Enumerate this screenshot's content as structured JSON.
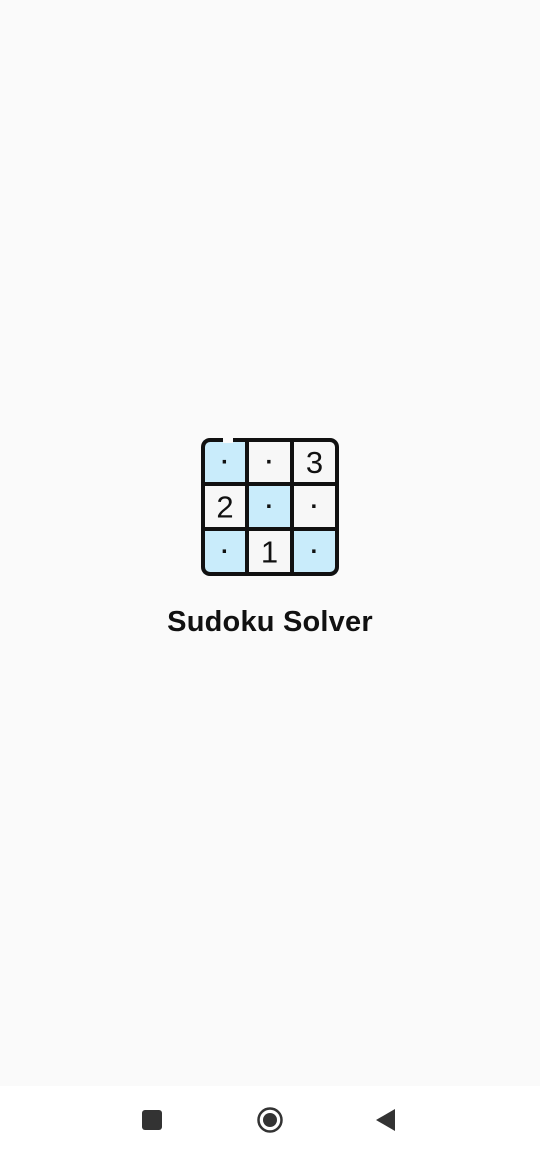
{
  "app": {
    "title": "Sudoku Solver"
  },
  "logo": {
    "icon": "sudoku-grid-icon",
    "cells": [
      {
        "value": "·",
        "shaded": true
      },
      {
        "value": "·",
        "shaded": false
      },
      {
        "value": "3",
        "shaded": false
      },
      {
        "value": "2",
        "shaded": false
      },
      {
        "value": "·",
        "shaded": true
      },
      {
        "value": "·",
        "shaded": false
      },
      {
        "value": "·",
        "shaded": true
      },
      {
        "value": "1",
        "shaded": false
      },
      {
        "value": "·",
        "shaded": true
      }
    ],
    "colors": {
      "shade": "#c9ecfb",
      "cell": "#f7f7f7",
      "stroke": "#111111"
    }
  },
  "navbar": {
    "recents_icon": "square-icon",
    "home_icon": "circle-home-icon",
    "back_icon": "triangle-back-icon"
  }
}
